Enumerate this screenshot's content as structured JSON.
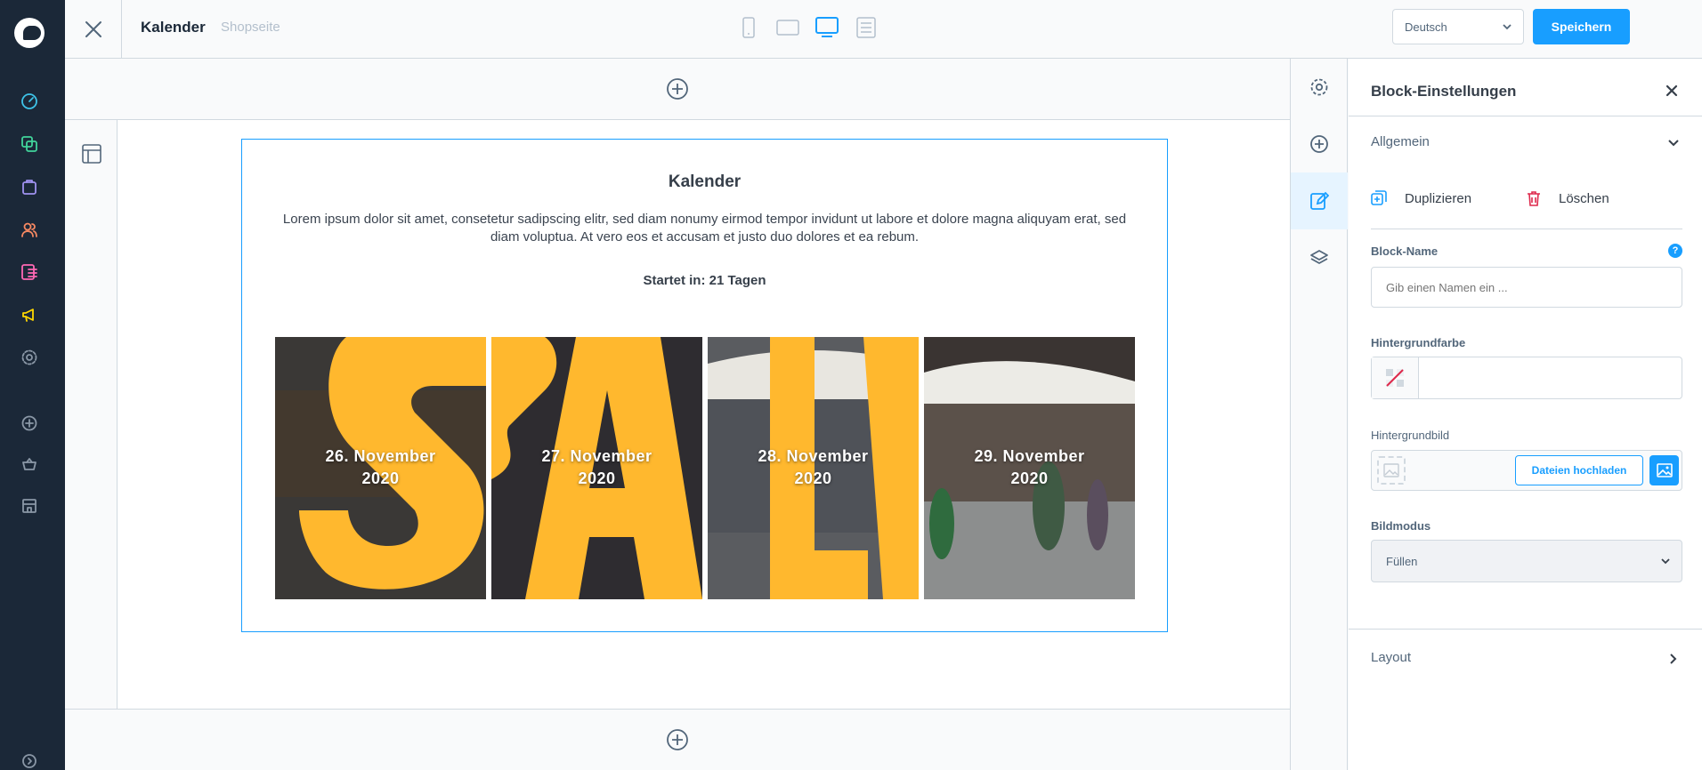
{
  "header": {
    "title": "Kalender",
    "subtitle": "Shopseite",
    "language": "Deutsch",
    "save_label": "Speichern",
    "devices": [
      "mobile-icon",
      "tablet-icon",
      "desktop-icon",
      "list-icon"
    ],
    "active_device": "desktop-icon"
  },
  "adminnav": {
    "icons": [
      "dashboard-icon",
      "catalog-icon",
      "orders-icon",
      "customers-icon",
      "content-icon",
      "marketing-icon",
      "settings-icon",
      "add-icon",
      "basket-icon",
      "store-icon"
    ]
  },
  "block": {
    "title": "Kalender",
    "description": "Lorem ipsum dolor sit amet, consetetur sadipscing elitr, sed diam nonumy eirmod tempor invidunt ut labore et dolore magna aliquyam erat, sed diam voluptua. At vero eos et accusam et justo duo dolores et ea rebum.",
    "countdown": "Startet in: 21 Tagen",
    "days": [
      {
        "line1": "26. November",
        "line2": "2020"
      },
      {
        "line1": "27. November",
        "line2": "2020"
      },
      {
        "line1": "28. November",
        "line2": "2020"
      },
      {
        "line1": "29. November",
        "line2": "2020"
      }
    ]
  },
  "panel": {
    "title": "Block-Einstellungen",
    "general_label": "Allgemein",
    "duplicate_label": "Duplizieren",
    "delete_label": "Löschen",
    "block_name_label": "Block-Name",
    "block_name_placeholder": "Gib einen Namen ein ...",
    "help_label": "?",
    "bg_color_label": "Hintergrundfarbe",
    "bg_image_label": "Hintergrundbild",
    "upload_label": "Dateien hochladen",
    "image_mode_label": "Bildmodus",
    "image_mode_value": "Füllen",
    "layout_label": "Layout"
  },
  "colors": {
    "accent": "#189eff",
    "nav_bg": "#1b2838",
    "sale_yellow": "#ffb82e"
  }
}
